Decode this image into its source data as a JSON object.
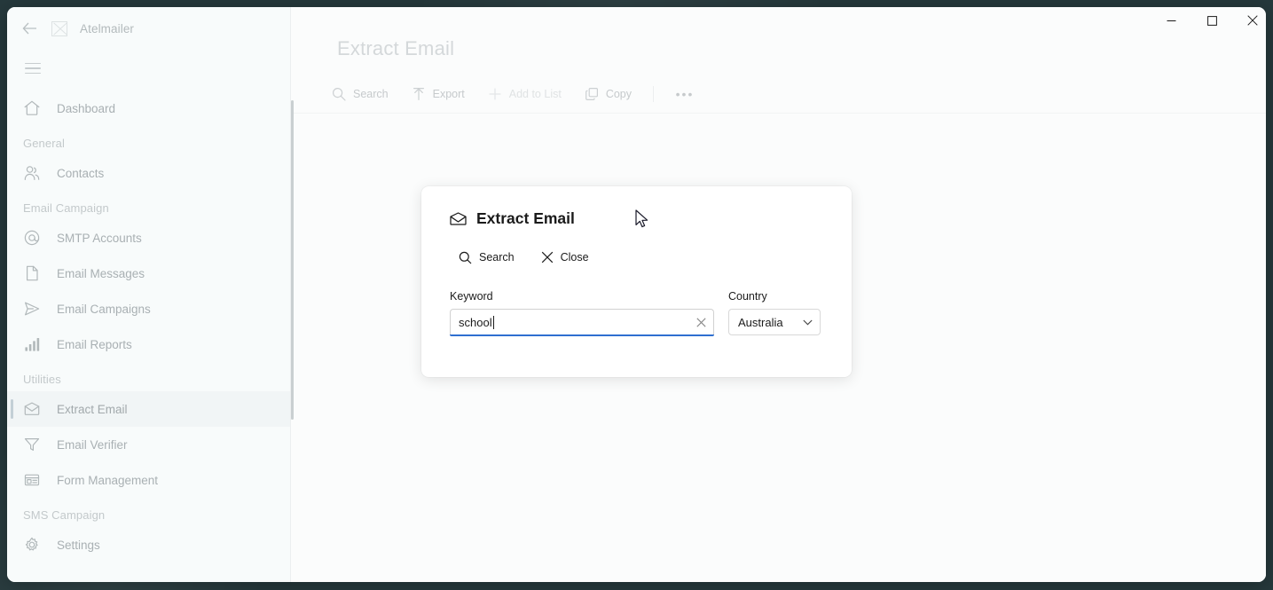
{
  "window": {
    "controls": [
      {
        "name": "minimize",
        "glyph": "minimize-icon"
      },
      {
        "name": "maximize",
        "glyph": "maximize-icon"
      },
      {
        "name": "close",
        "glyph": "close-icon"
      }
    ]
  },
  "sidebar": {
    "back_icon": "back-arrow-icon",
    "logo_icon": "broken-image-icon",
    "brand": "Atelmailer",
    "menu_icon": "hamburger-icon",
    "items": [
      {
        "type": "item",
        "label": "Dashboard",
        "icon": "home-icon",
        "active": false
      },
      {
        "type": "section",
        "label": "General"
      },
      {
        "type": "item",
        "label": "Contacts",
        "icon": "people-icon",
        "active": false
      },
      {
        "type": "section",
        "label": "Email Campaign"
      },
      {
        "type": "item",
        "label": "SMTP Accounts",
        "icon": "at-icon",
        "active": false
      },
      {
        "type": "item",
        "label": "Email Messages",
        "icon": "document-icon",
        "active": false
      },
      {
        "type": "item",
        "label": "Email Campaigns",
        "icon": "send-icon",
        "active": false
      },
      {
        "type": "item",
        "label": "Email Reports",
        "icon": "bar-chart-icon",
        "active": false
      },
      {
        "type": "section",
        "label": "Utilities"
      },
      {
        "type": "item",
        "label": "Extract Email",
        "icon": "envelope-icon",
        "active": true
      },
      {
        "type": "item",
        "label": "Email Verifier",
        "icon": "funnel-icon",
        "active": false
      },
      {
        "type": "item",
        "label": "Form Management",
        "icon": "form-icon",
        "active": false
      },
      {
        "type": "section",
        "label": "SMS Campaign"
      },
      {
        "type": "item",
        "label": "Settings",
        "icon": "gear-icon",
        "active": false
      }
    ]
  },
  "main": {
    "page_title": "Extract Email",
    "toolbar": [
      {
        "label": "Search",
        "icon": "search-icon",
        "disabled": false
      },
      {
        "label": "Export",
        "icon": "export-icon",
        "disabled": false
      },
      {
        "label": "Add to List",
        "icon": "plus-icon",
        "disabled": true
      },
      {
        "label": "Copy",
        "icon": "copy-icon",
        "disabled": false
      }
    ],
    "overflow_label": "•••"
  },
  "modal": {
    "title": "Extract Email",
    "title_icon": "envelope-icon",
    "actions": [
      {
        "label": "Search",
        "icon": "search-icon"
      },
      {
        "label": "Close",
        "icon": "close-icon"
      }
    ],
    "keyword": {
      "label": "Keyword",
      "value": "school",
      "placeholder": "",
      "clear_icon": "clear-x-icon",
      "focused": true
    },
    "country": {
      "label": "Country",
      "value": "Australia",
      "chevron_icon": "chevron-down-icon"
    }
  },
  "colors": {
    "desktop": "#26393c",
    "sidebar_bg": "#f8fbfb",
    "main_bg": "#fbfcfc",
    "focus_underline": "#2f6fd0",
    "active_accent": "#c3cfd6",
    "muted_text": "#a9b0b3"
  }
}
